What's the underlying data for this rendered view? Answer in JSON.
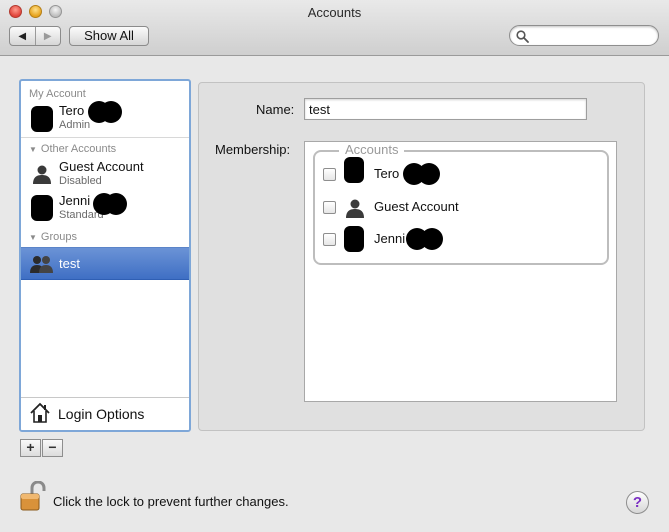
{
  "window": {
    "title": "Accounts"
  },
  "toolbar": {
    "back_glyph": "◀",
    "forward_glyph": "▶",
    "show_all_label": "Show All",
    "search_placeholder": ""
  },
  "sidebar": {
    "my_account_header": "My Account",
    "my_account": {
      "name": "Tero",
      "role": "Admin"
    },
    "other_accounts_header": "Other Accounts",
    "other_accounts": [
      {
        "name": "Guest Account",
        "status": "Disabled"
      },
      {
        "name": "Jenni",
        "status": "Standard"
      }
    ],
    "groups_header": "Groups",
    "groups": [
      {
        "name": "test",
        "selected": true
      }
    ],
    "login_options_label": "Login Options",
    "add_label": "+",
    "remove_label": "−"
  },
  "detail": {
    "name_label": "Name:",
    "name_value": "test",
    "membership_label": "Membership:",
    "membership_group_title": "Accounts",
    "members": [
      {
        "name": "Tero",
        "checked": false
      },
      {
        "name": "Guest Account",
        "checked": false
      },
      {
        "name": "Jenni",
        "checked": false
      }
    ]
  },
  "footer": {
    "lock_text": "Click the lock to prevent further changes.",
    "help_glyph": "?"
  },
  "colors": {
    "selection": "#3f6fc4",
    "list_focus_ring": "#7ea7d8",
    "help_accent": "#7b2fc3"
  }
}
